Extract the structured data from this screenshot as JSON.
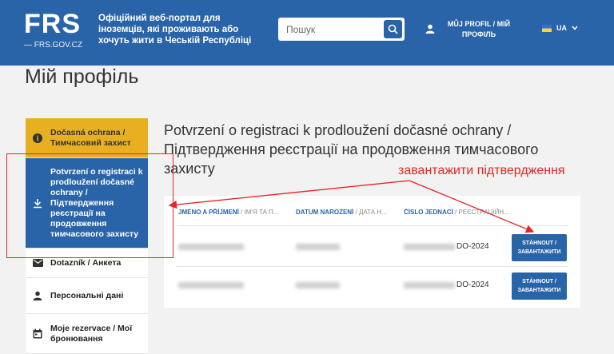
{
  "header": {
    "logo": "FRS",
    "logo_sub": "— FRS.GOV.CZ",
    "tagline": "Офіційний веб-портал для іноземців, які проживають або хочуть жити в Чеській Республіці",
    "search_placeholder": "Пошук",
    "profile_link": "MŮJ PROFIL / МІЙ ПРОФІЛЬ",
    "language": "UA"
  },
  "page_title": "Мій профіль",
  "sidebar": {
    "items": [
      {
        "label": "Dočasná ochrana / Тимчасовий захист",
        "icon": "info-icon"
      },
      {
        "label": "Potvrzení o registraci k prodloužení dočasné ochrany / Підтвердження реєстрації на продовження тимчасового захисту",
        "icon": "download-icon"
      },
      {
        "label": "Dotazník / Анкета",
        "icon": "mail-icon"
      },
      {
        "label": "Персональні дані",
        "icon": "person-icon"
      },
      {
        "label": "Moje rezervace / Мої бронювання",
        "icon": "calendar-icon"
      }
    ]
  },
  "content": {
    "title": "Potvrzení o registraci k prodloužení dočasné ochrany / Підтвердження реєстрації на продовження тимчасового захисту",
    "columns": [
      {
        "primary": "JMÉNO A PŘÍJMENÍ",
        "secondary": " / ІМ'Я ТА П..."
      },
      {
        "primary": "DATUM NAROZENÍ",
        "secondary": " / ДАТА Н..."
      },
      {
        "primary": "ČÍSLO JEDNACÍ",
        "secondary": " / РЕЄСТРАЦІЙН..."
      }
    ],
    "rows": [
      {
        "code_suffix": "DO-2024",
        "button": "STÁHNOUT / ЗАВАНТАЖИТИ"
      },
      {
        "code_suffix": "DO-2024",
        "button": "STÁHNOUT / ЗАВАНТАЖИТИ"
      }
    ]
  },
  "annotation": {
    "text": "завантажити підтвердження",
    "color": "#e32626"
  },
  "colors": {
    "brand_blue": "#2a64a8",
    "accent_yellow": "#e8b020"
  }
}
